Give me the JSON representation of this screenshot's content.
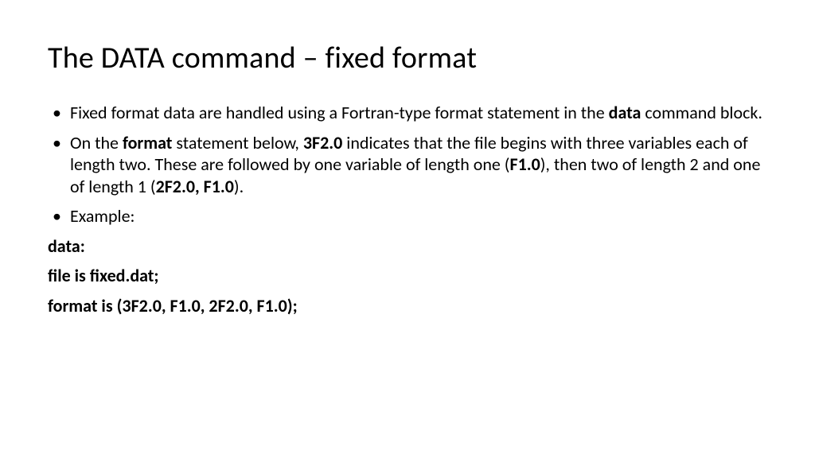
{
  "title": "The DATA command – fixed format",
  "bullet1": {
    "pre": "Fixed format data are handled using a Fortran-type format statement in the ",
    "k1": "data",
    "post": " command block."
  },
  "bullet2": {
    "p1": "On the ",
    "k1": "format",
    "p2": " statement below, ",
    "k2": "3F2.0",
    "p3": " indicates that the file begins with three variables each of length two. These are followed by one variable of length one (",
    "k3": "F1.0",
    "p4": "), then two of length 2 and one of length 1 (",
    "k4": "2F2.0, F1.0",
    "p5": ")."
  },
  "bullet3": "Example:",
  "code": {
    "l1": "data:",
    "l2": "file is fixed.dat;",
    "l3": "format is (3F2.0, F1.0, 2F2.0, F1.0);"
  }
}
